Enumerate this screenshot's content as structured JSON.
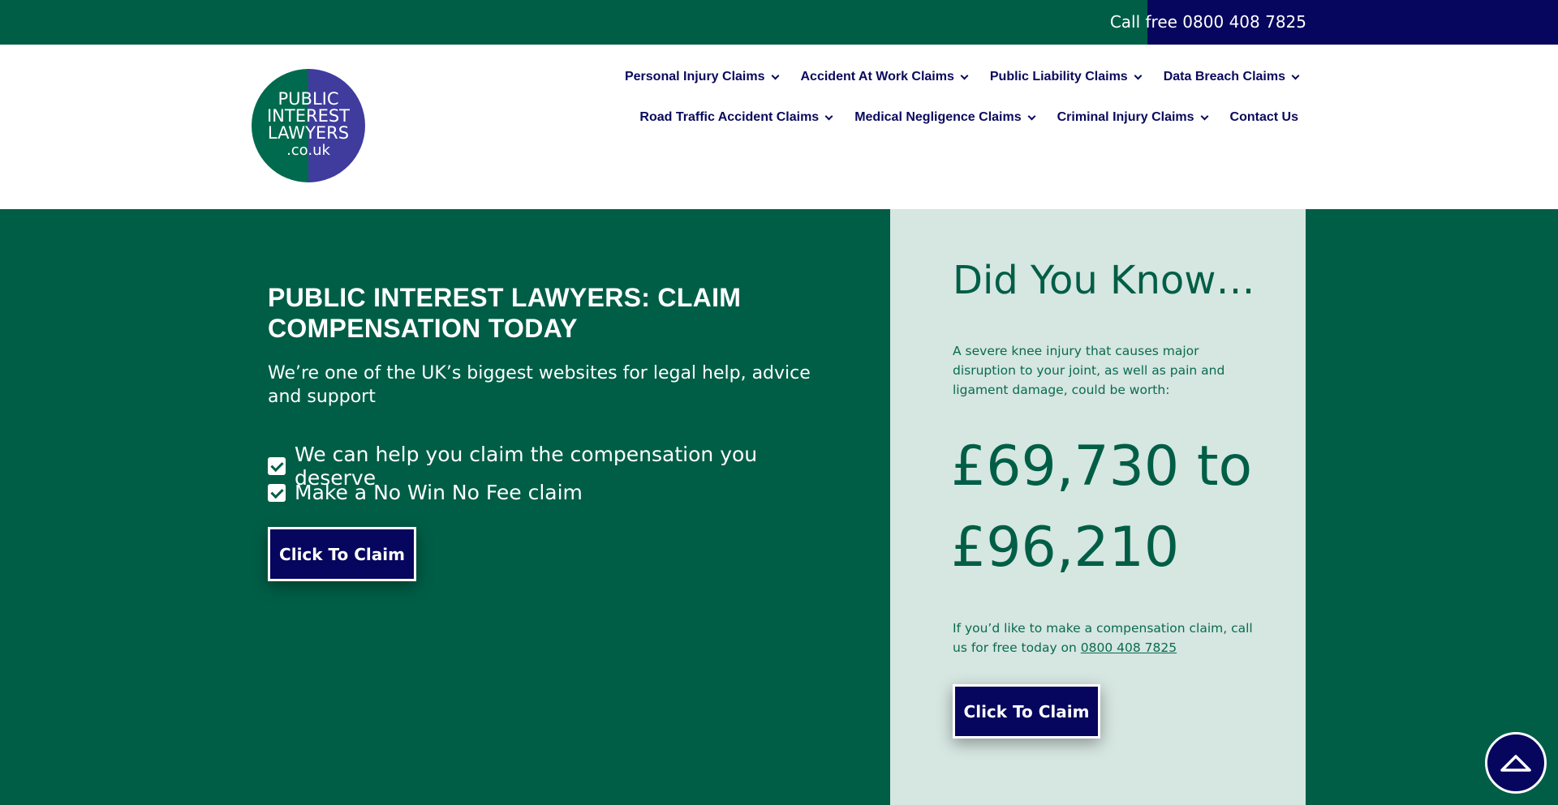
{
  "topbar": {
    "phone_text": "Call free 0800 408 7825",
    "colors": {
      "green": "#005e46",
      "navy": "#06065e"
    }
  },
  "logo": {
    "lines": [
      "PUBLIC",
      "INTEREST",
      "LAWYERS",
      ".co.uk"
    ]
  },
  "nav": {
    "row1": [
      {
        "label": "Personal Injury Claims",
        "icon": "chevron-down-icon"
      },
      {
        "label": "Accident At Work Claims",
        "icon": "chevron-down-icon"
      },
      {
        "label": "Public Liability Claims",
        "icon": "chevron-down-icon"
      },
      {
        "label": "Data Breach Claims",
        "icon": "chevron-down-icon"
      }
    ],
    "row2": [
      {
        "label": "Road Traffic Accident Claims",
        "icon": "chevron-down-icon"
      },
      {
        "label": "Medical Negligence Claims",
        "icon": "chevron-down-icon"
      },
      {
        "label": "Criminal Injury Claims",
        "icon": "chevron-down-icon"
      },
      {
        "label": "Contact Us"
      }
    ]
  },
  "hero": {
    "title": "PUBLIC INTEREST LAWYERS: CLAIM COMPENSATION TODAY",
    "subtitle": "We’re one of the UK’s biggest websites for legal help, advice and support",
    "checks": [
      "We can help you claim the compensation you deserve",
      "Make a No Win No Fee claim"
    ],
    "button_label": "Click To Claim"
  },
  "did_you_know": {
    "title": "Did You Know…",
    "body": "A severe knee injury that causes major disruption to your joint, as well as pain and ligament damage, could be worth:",
    "amount_line1": "£69,730 to",
    "amount_line2": "£96,210",
    "cta_text": "If you’d like to make a compensation claim, call us for free today on",
    "cta_phone": "0800 408 7825",
    "button_label": "Click To Claim",
    "colors": {
      "panel_bg": "#d6e6e1",
      "text": "#005e46"
    }
  },
  "scroll_top": {
    "icon": "chevron-up-icon"
  }
}
